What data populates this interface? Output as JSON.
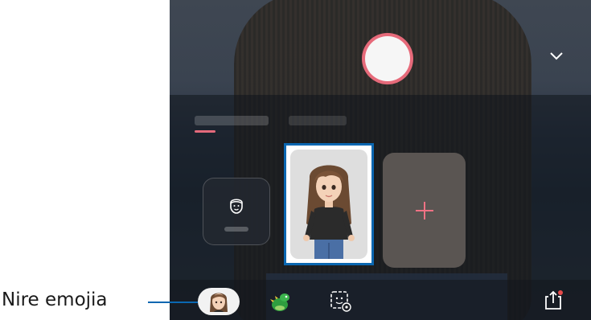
{
  "callout": {
    "label": "Nire emojia"
  },
  "camera": {
    "tabs": [
      {
        "label": ""
      },
      {
        "label": ""
      }
    ],
    "create_card_label": "",
    "add_card_icon": "plus-icon",
    "bottom_icons": [
      "avatar-icon",
      "dinosaur-icon",
      "sticker-settings-icon",
      "share-icon"
    ],
    "chevron_icon": "chevron-down-icon"
  },
  "colors": {
    "accent": "#e66a7a",
    "callout_blue": "#0a67b1",
    "card_gray": "#5a5552"
  }
}
